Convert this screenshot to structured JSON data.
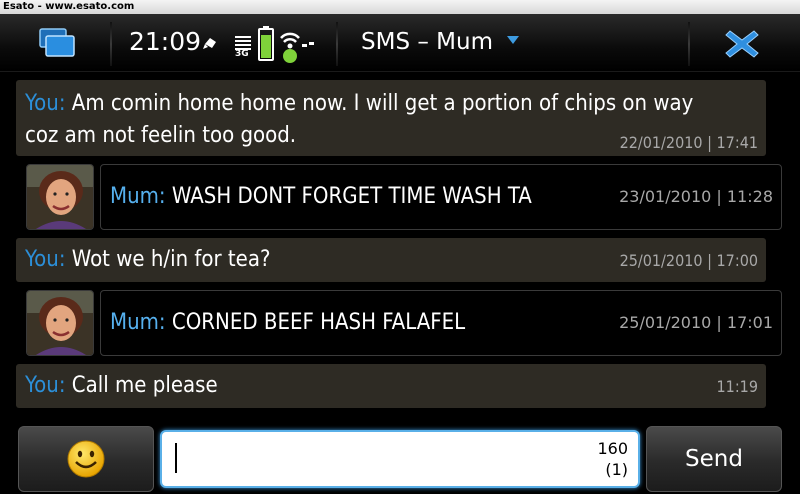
{
  "watermark": "Esato - www.esato.com",
  "status_bar": {
    "time": "21:09",
    "network": "3G",
    "conversation_title": "SMS – Mum"
  },
  "messages": [
    {
      "sender": "You:",
      "text": " Am comin home home now. I will get a portion of chips on way",
      "text2": "coz am not feelin too good.",
      "timestamp": "22/01/2010 | 17:41"
    },
    {
      "sender": "Mum:",
      "text": " WASH DONT FORGET TIME WASH TA",
      "timestamp": "23/01/2010 | 11:28"
    },
    {
      "sender": "You:",
      "text": " Wot we h/in for tea?",
      "timestamp": "25/01/2010 | 17:00"
    },
    {
      "sender": "Mum:",
      "text": " CORNED BEEF HASH FALAFEL",
      "timestamp": "25/01/2010 | 17:01"
    },
    {
      "sender": "You:",
      "text": " Call me please",
      "timestamp": "11:19"
    }
  ],
  "composer": {
    "char_count": "160",
    "message_count": "(1)",
    "send_label": "Send"
  },
  "colors": {
    "you_sender": "#2c8fd8",
    "mum_sender": "#56b0ee",
    "outgoing_bubble": "#2e2b24",
    "input_focus": "#5ab0e8"
  }
}
